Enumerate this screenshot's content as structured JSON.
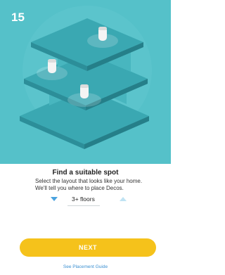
{
  "step": {
    "number": "15"
  },
  "illustration": {
    "icon": "decos-multi-floor-house-illustration",
    "colors": {
      "background": "#55c1c9",
      "floor_top": "#3aa8b2",
      "floor_side": "#2c8e99",
      "wall": "#48b6bf"
    }
  },
  "content": {
    "title": "Find a suitable spot",
    "description_line1": "Select the layout that looks like your home.",
    "description_line2": "We'll tell you where to place Decos."
  },
  "floor_selector": {
    "value": "3+ floors",
    "decrease_icon": "triangle-down-icon",
    "increase_icon": "triangle-up-icon",
    "accent_color": "#4aa3df"
  },
  "actions": {
    "next_label": "NEXT",
    "next_color": "#f5c21b",
    "guide_link": "See Placement Guide"
  }
}
